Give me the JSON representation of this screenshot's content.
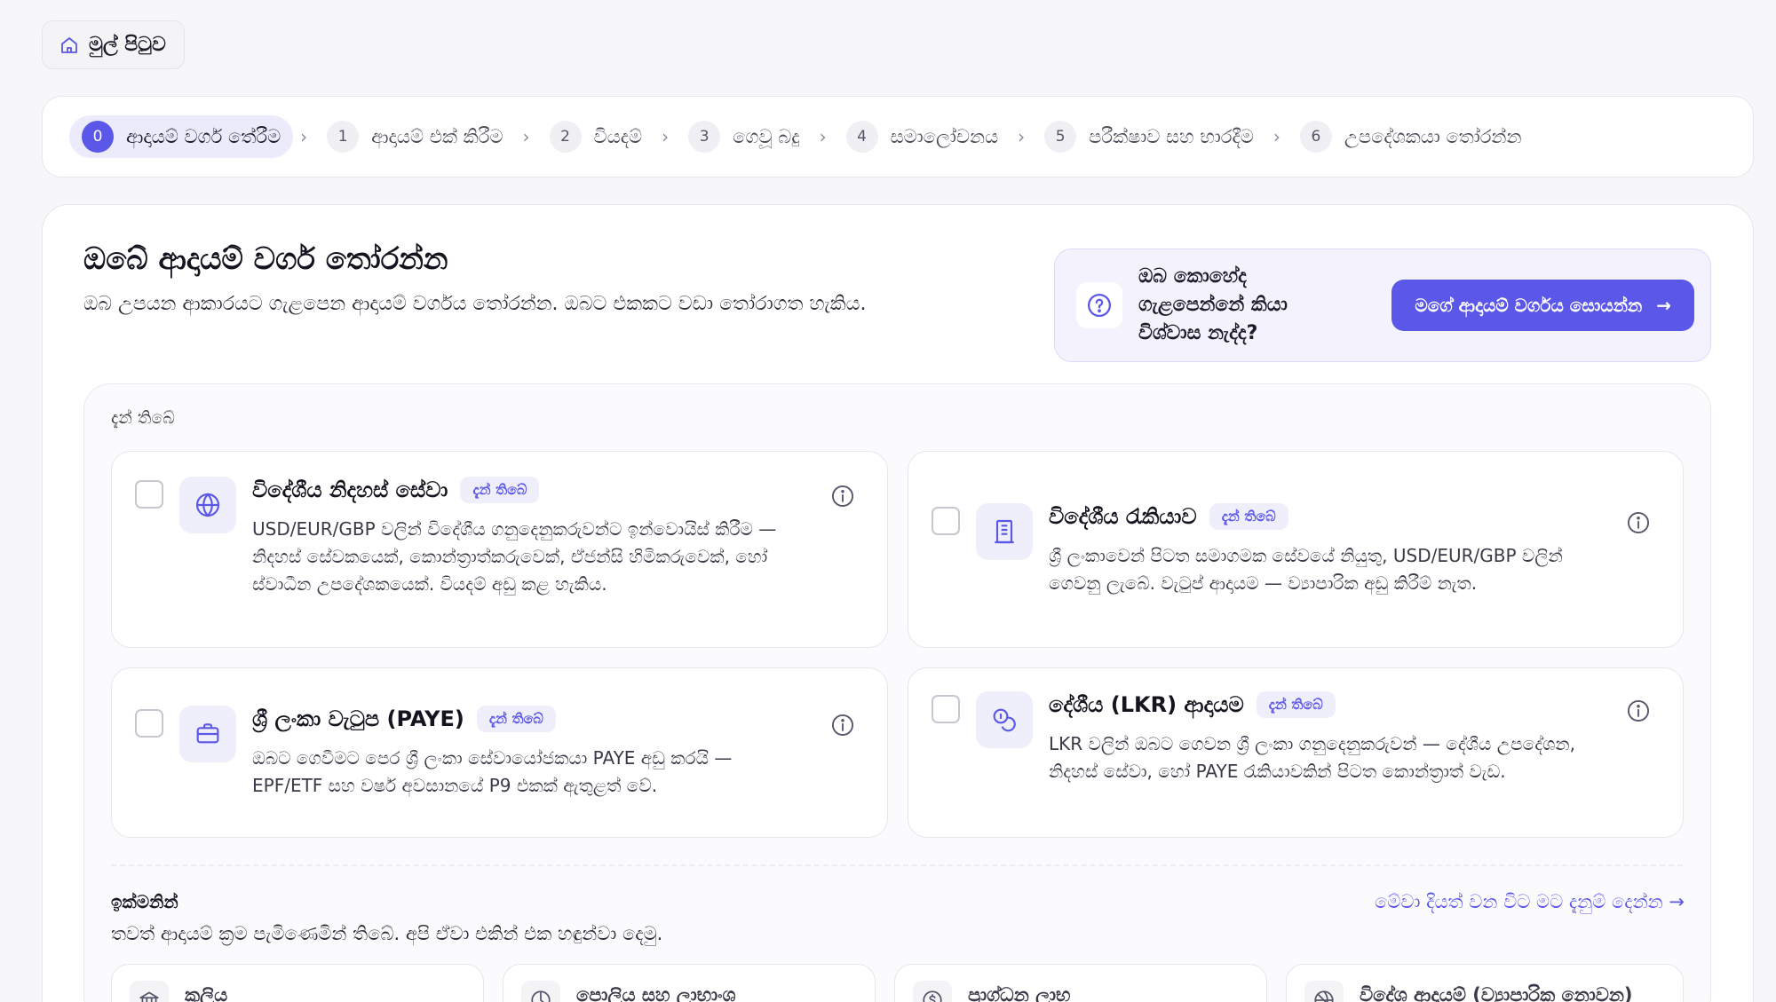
{
  "home": {
    "label": "මුල් පිටුව",
    "icon": "home-icon"
  },
  "stepper": {
    "steps": [
      {
        "num": "0",
        "label": "ආදායම් වර්ග තේරීම"
      },
      {
        "num": "1",
        "label": "ආදායම් එක් කිරීම"
      },
      {
        "num": "2",
        "label": "වියදම්"
      },
      {
        "num": "3",
        "label": "ගෙවූ බදු"
      },
      {
        "num": "4",
        "label": "සමාලෝචනය"
      },
      {
        "num": "5",
        "label": "පරීක්ෂාව සහ භාරදීම"
      },
      {
        "num": "6",
        "label": "උපදේශකයා තෝරන්න"
      }
    ],
    "separator": "›",
    "active_index": 0
  },
  "header": {
    "title": "ඔබේ ආදායම් වර්ග තෝරන්න",
    "subtitle": "ඔබ උපයන ආකාරයට ගැළපෙන ආදායම් වර්ගය තෝරන්න. ඔබට එකකට වඩා තෝරාගත හැකිය."
  },
  "help": {
    "icon": "question-circle-icon",
    "text": "ඔබ කොහේද ගැළපෙන්නේ කියා විශ්වාස නැද්ද?",
    "cta_label": "මගේ ආදායම් වර්ගය සොයන්න",
    "cta_arrow": "→"
  },
  "available": {
    "label": "දැන් තිබේ",
    "cards": [
      {
        "icon": "globe-icon",
        "title": "විදේශීය නිදහස් සේවා",
        "badge": "දැන් තිබේ",
        "description": "USD/EUR/GBP වලින් විදේශීය ගනුදෙනුකරුවන්ට ඉන්වොයිස් කිරීම — නිදහස් සේවකයෙක්, කොන්ත්‍රාත්කරුවෙක්, ඒජන්සි හිමිකරුවෙක්, හෝ ස්වාධීන උපදේශකයෙක්. වියදම් අඩු කළ හැකිය.",
        "checked": false
      },
      {
        "icon": "building-icon",
        "title": "විදේශීය රැකියාව",
        "badge": "දැන් තිබේ",
        "description": "ශ්‍රී ලංකාවෙන් පිටත සමාගමක සේවයේ නියුතු, USD/EUR/GBP වලින් ගෙවනු ලැබේ. වැටුප් ආදායම — ව්‍යාපාරික අඩු කිරීම් නැත.",
        "checked": false
      },
      {
        "icon": "briefcase-icon",
        "title": "ශ්‍රී ලංකා වැටුප (PAYE)",
        "badge": "දැන් තිබේ",
        "description": "ඔබට ගෙවීමට පෙර ශ්‍රී ලංකා සේවායෝජකයා PAYE අඩු කරයි — EPF/ETF සහ වර්ෂ අවසානයේ P9 එකක් ඇතුළත් වේ.",
        "checked": false
      },
      {
        "icon": "coins-icon",
        "title": "දේශීය (LKR) ආදායම",
        "badge": "දැන් තිබේ",
        "description": "LKR වලින් ඔබට ගෙවන ශ්‍රී ලංකා ගනුදෙනුකරුවන් — දේශීය උපදේශන, නිදහස් සේවා, හෝ PAYE රැකියාවකින් පිටත කොන්ත්‍රාත් වැඩ.",
        "checked": false
      }
    ],
    "info_icon": "info-icon"
  },
  "coming_soon": {
    "label": "ඉක්මනින්",
    "subtitle": "තවත් ආදායම් ක්‍රම පැමිණෙමින් තිබේ. අපි ඒවා එකින් එක හඳුන්වා දෙමු.",
    "notify_link": "මේවා දියත් වන විට මට දැනුම් දෙන්න →",
    "cards": [
      {
        "icon": "bank-icon",
        "title": "කුලිය"
      },
      {
        "icon": "chart-icon",
        "title": "පොලිය සහ ලාභාංශ"
      },
      {
        "icon": "dollar-circle-icon",
        "title": "ප්‍රාග්ධන ලාභ"
      },
      {
        "icon": "globe-crossed-icon",
        "title": "විදේශ ආදායම් (ව්‍යාපාරික නොවන)"
      }
    ]
  },
  "colors": {
    "accent": "#5b57e8",
    "badge_bg": "#efeefb",
    "page_bg": "#f7f7f9"
  }
}
